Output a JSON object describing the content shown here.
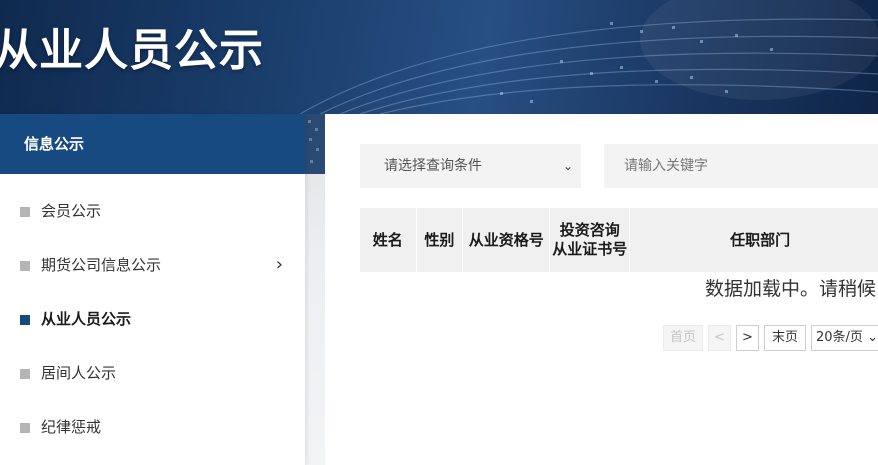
{
  "banner": {
    "title": "从业人员公示"
  },
  "sidebar": {
    "header": "信息公示",
    "items": [
      {
        "label": "会员公示"
      },
      {
        "label": "期货公司信息公示"
      },
      {
        "label": "从业人员公示"
      },
      {
        "label": "居间人公示"
      },
      {
        "label": "纪律惩戒"
      }
    ],
    "active_index": 2
  },
  "search": {
    "select_placeholder": "请选择查询条件",
    "keyword_placeholder": "请输入关键字"
  },
  "table": {
    "headers": [
      "姓名",
      "性别",
      "从业资格号",
      "投资咨询\n从业证书号",
      "任职部门"
    ],
    "loading_text": "数据加载中。请稍候"
  },
  "pagination": {
    "first": "首页",
    "prev": "<",
    "next": ">",
    "last": "末页",
    "page_size": "20条/页"
  },
  "colors": {
    "primary": "#184a82",
    "accent_bg": "#f0f0f0"
  }
}
